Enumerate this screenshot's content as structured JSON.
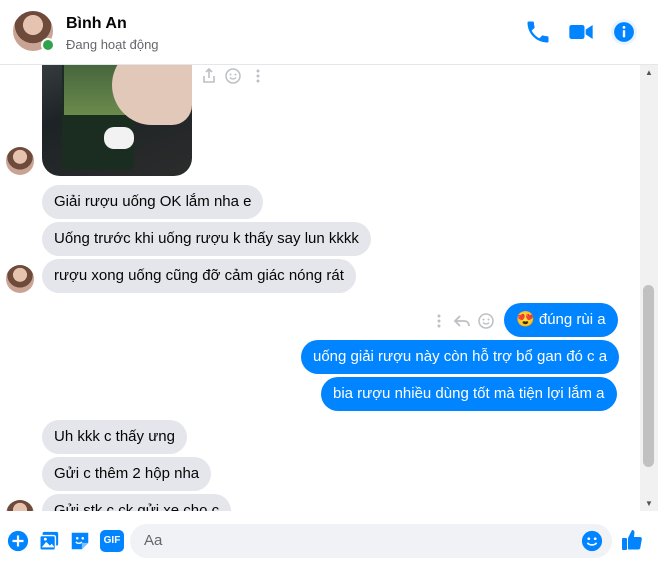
{
  "header": {
    "name": "Bình An",
    "status": "Đang hoạt động"
  },
  "messages": [
    {
      "side": "in",
      "text": "Giải rượu uống OK lắm nha e"
    },
    {
      "side": "in",
      "text": "Uống trước khi uống rượu k thấy say lun kkkk"
    },
    {
      "side": "in",
      "text": "rượu xong uống cũng đỡ cảm giác nóng rát"
    },
    {
      "side": "out",
      "emoji": "😍",
      "text": "đúng rùi a"
    },
    {
      "side": "out",
      "text": "uống giải rượu này còn hỗ trợ bổ gan đó c a"
    },
    {
      "side": "out",
      "text": "bia rượu nhiều dùng tốt mà tiện lợi lắm a"
    },
    {
      "side": "in",
      "text": "Uh kkk c thấy ưng"
    },
    {
      "side": "in",
      "text": "Gửi c thêm 2 hộp nha"
    },
    {
      "side": "in",
      "text": "Gửi stk c ck gửi xe cho c"
    }
  ],
  "composer": {
    "placeholder": "Aa",
    "gif_label": "GIF"
  },
  "colors": {
    "accent": "#0084ff",
    "incoming_bubble": "#e4e6eb",
    "online": "#31a24c"
  }
}
